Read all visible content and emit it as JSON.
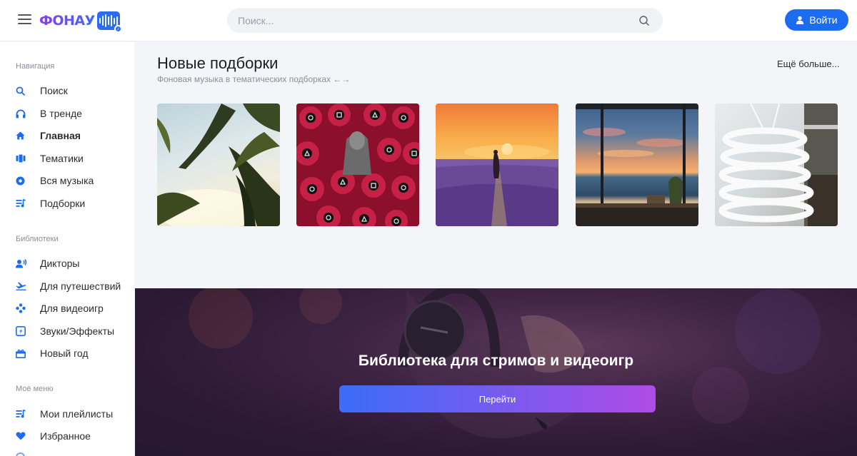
{
  "header": {
    "logo_text": "ФОНАУ",
    "search_placeholder": "Поиск...",
    "login_label": "Войти"
  },
  "sidebar": {
    "sections": [
      {
        "title": "Навигация",
        "items": [
          {
            "label": "Поиск",
            "icon": "search-icon"
          },
          {
            "label": "В тренде",
            "icon": "headphones-icon"
          },
          {
            "label": "Главная",
            "icon": "home-icon",
            "active": true
          },
          {
            "label": "Тематики",
            "icon": "tags-icon"
          },
          {
            "label": "Вся музыка",
            "icon": "disc-icon"
          },
          {
            "label": "Подборки",
            "icon": "playlist-icon"
          }
        ]
      },
      {
        "title": "Библиотеки",
        "items": [
          {
            "label": "Дикторы",
            "icon": "voice-icon"
          },
          {
            "label": "Для путешествий",
            "icon": "airplane-icon"
          },
          {
            "label": "Для видеоигр",
            "icon": "gamepad-icon"
          },
          {
            "label": "Звуки/Эффекты",
            "icon": "sound-effect-icon"
          },
          {
            "label": "Новый год",
            "icon": "gift-icon"
          }
        ]
      },
      {
        "title": "Моё меню",
        "items": [
          {
            "label": "Мои плейлисты",
            "icon": "playlist-icon"
          },
          {
            "label": "Избранное",
            "icon": "heart-icon"
          }
        ]
      }
    ]
  },
  "main": {
    "title": "Новые подборки",
    "subtitle": "Фоновая музыка в тематических подборках ←→",
    "more_label": "Ещё больше...",
    "cards": [
      {
        "image": "palm-trees-sky-image"
      },
      {
        "image": "red-guards-crowd-image"
      },
      {
        "image": "lavender-sunset-field-image"
      },
      {
        "image": "window-sea-sunset-image"
      },
      {
        "image": "white-spiral-lamp-interior-image"
      }
    ]
  },
  "banner": {
    "title": "Библиотека для стримов и видеоигр",
    "button_label": "Перейти",
    "image": "girl-with-headphones-neon-image"
  },
  "colors": {
    "accent": "#1c6cf2",
    "banner_button_start": "#3b6cf8",
    "banner_button_end": "#b04be6"
  }
}
